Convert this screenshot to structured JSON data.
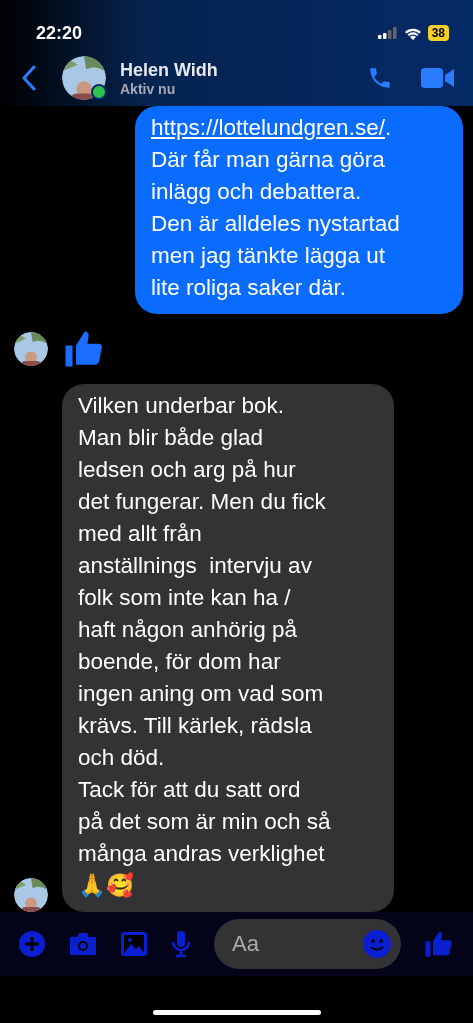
{
  "status_bar": {
    "time": "22:20",
    "battery": "38"
  },
  "header": {
    "name": "Helen Widh",
    "status": "Aktiv nu",
    "online": true
  },
  "messages": [
    {
      "kind": "outgoing",
      "link": "https://lottelundgren.se/",
      "lines": [
        ".",
        "Där får man gärna göra",
        "inlägg och debattera.",
        "Den är alldeles nystartad",
        "men jag tänkte lägga ut",
        "lite roliga saker där."
      ]
    },
    {
      "kind": "like"
    },
    {
      "kind": "incoming",
      "lines": [
        "Vilken underbar bok.",
        "Man blir både glad",
        "ledsen och arg på hur",
        "det fungerar. Men du fick",
        "med allt från",
        "anställnings  intervju av",
        "folk som inte kan ha /",
        "haft någon anhörig på",
        "boende, för dom har",
        "ingen aning om vad som",
        "krävs. Till kärlek, rädsla",
        "och död.",
        "Tack för att du satt ord",
        "på det som är min och så",
        "många andras verklighet",
        "🙏🥰"
      ]
    }
  ],
  "composer": {
    "placeholder": "Aa"
  }
}
